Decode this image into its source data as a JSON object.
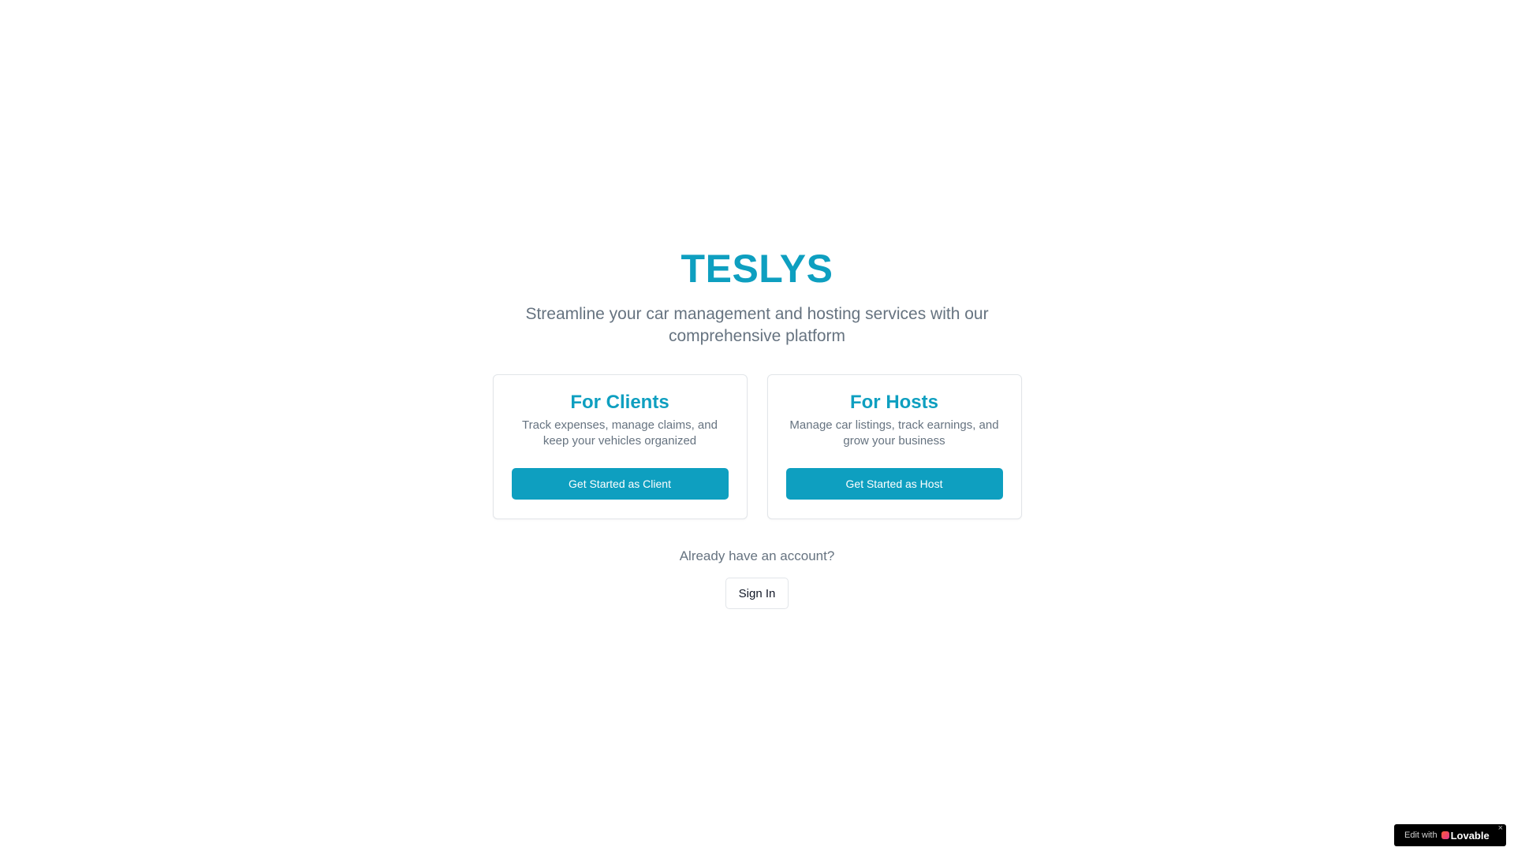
{
  "brand": {
    "name": "TESLYS",
    "color": "#0e9fc0"
  },
  "hero": {
    "tagline": "Streamline your car management and hosting services with our comprehensive platform"
  },
  "cards": [
    {
      "title": "For Clients",
      "description": "Track expenses, manage claims, and keep your vehicles organized",
      "button_label": "Get Started as Client"
    },
    {
      "title": "For Hosts",
      "description": "Manage car listings, track earnings, and grow your business",
      "button_label": "Get Started as Host"
    }
  ],
  "signin_section": {
    "prompt": "Already have an account?",
    "button_label": "Sign In"
  },
  "lovable_badge": {
    "prefix": "Edit with",
    "brand": "Lovable",
    "close_icon": "close-icon",
    "close_glyph": "×"
  }
}
